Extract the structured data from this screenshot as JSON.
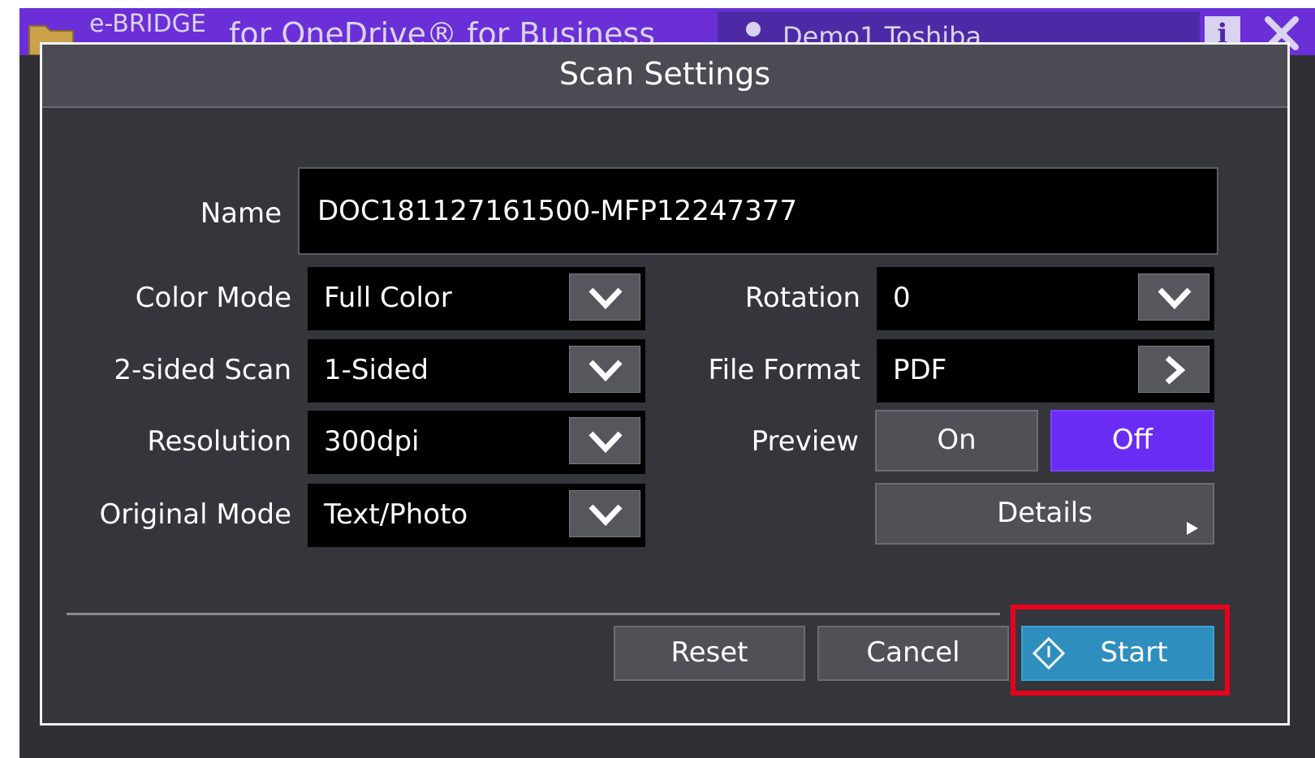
{
  "app": {
    "name_small": "e-BRIDGE",
    "name_large": "for OneDrive® for Business",
    "user_name": "Demo1 Toshiba",
    "info_label": "i"
  },
  "dialog": {
    "title": "Scan Settings",
    "name_label": "Name",
    "name_value": "DOC181127161500-MFP12247377",
    "fields": {
      "color_mode": {
        "label": "Color Mode",
        "value": "Full Color"
      },
      "two_sided_scan": {
        "label": "2-sided Scan",
        "value": "1-Sided"
      },
      "resolution": {
        "label": "Resolution",
        "value": "300dpi"
      },
      "original_mode": {
        "label": "Original Mode",
        "value": "Text/Photo"
      },
      "rotation": {
        "label": "Rotation",
        "value": "0"
      },
      "file_format": {
        "label": "File Format",
        "value": "PDF"
      }
    },
    "preview": {
      "label": "Preview",
      "on_label": "On",
      "off_label": "Off",
      "selected": "Off"
    },
    "details_label": "Details",
    "buttons": {
      "reset": "Reset",
      "cancel": "Cancel",
      "start": "Start"
    }
  },
  "colors": {
    "frame_purple": "#6a2fd6",
    "active_toggle": "#6a2cf5",
    "start_button": "#2e8fbf",
    "highlight_red": "#e8001c"
  }
}
